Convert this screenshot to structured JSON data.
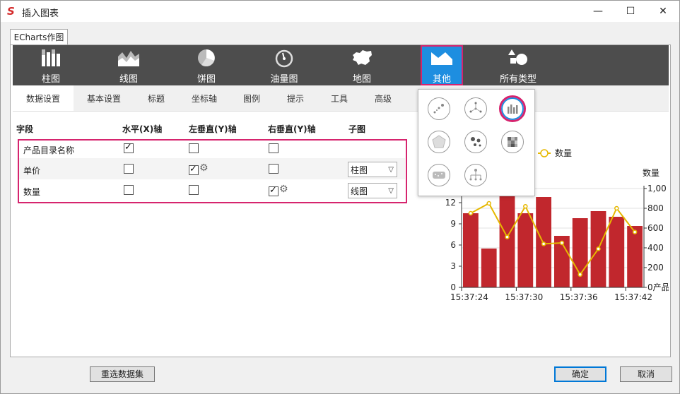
{
  "window": {
    "title": "插入图表",
    "app_icon": "S",
    "minimize": "—",
    "maximize": "☐",
    "close": "✕"
  },
  "tab": {
    "label": "ECharts作图"
  },
  "chart_types": [
    {
      "label": "柱图",
      "icon": "bar-chart-icon"
    },
    {
      "label": "线图",
      "icon": "line-chart-icon"
    },
    {
      "label": "饼图",
      "icon": "pie-chart-icon"
    },
    {
      "label": "油量图",
      "icon": "gauge-icon"
    },
    {
      "label": "地图",
      "icon": "map-icon"
    },
    {
      "label": "其他",
      "icon": "other-chart-icon",
      "selected": true
    },
    {
      "label": "所有类型",
      "icon": "all-types-icon"
    }
  ],
  "subtabs": [
    "数据设置",
    "基本设置",
    "标题",
    "坐标轴",
    "图例",
    "提示",
    "工具",
    "高级"
  ],
  "columns": {
    "field": "字段",
    "x_axis": "水平(X)轴",
    "left_y": "左垂直(Y)轴",
    "right_y": "右垂直(Y)轴",
    "sub_chart": "子图"
  },
  "rows": [
    {
      "name": "产品目录名称",
      "x": true,
      "left": false,
      "right": false,
      "sub": ""
    },
    {
      "name": "单价",
      "x": false,
      "left": true,
      "right": false,
      "sub": "柱图"
    },
    {
      "name": "数量",
      "x": false,
      "left": false,
      "right": true,
      "sub": "线图"
    }
  ],
  "preview": {
    "legend": "数量",
    "right_axis_title": "数量",
    "left_ticks": [
      "12",
      "9",
      "6",
      "3",
      "0"
    ],
    "right_ticks": [
      "1,00",
      "800",
      "600",
      "400",
      "200",
      "0产品"
    ],
    "x_ticks": [
      "15:37:24",
      "15:37:30",
      "15:37:36",
      "15:37:42"
    ],
    "bar_color": "#c1272d",
    "line_color": "#e6b800"
  },
  "chart_data": {
    "type": "bar",
    "series": [
      {
        "values": [
          10.5,
          5.5,
          13.8,
          10.5,
          12.8,
          7.3,
          9.8,
          10.8,
          10.0,
          8.7
        ]
      },
      {
        "name": "数量",
        "values": [
          750,
          850,
          510,
          820,
          440,
          450,
          130,
          390,
          800,
          560
        ]
      }
    ],
    "ylim": [
      0,
      14
    ],
    "y2lim": [
      0,
      1000
    ]
  },
  "buttons": {
    "reselect": "重选数据集",
    "ok": "确定",
    "cancel": "取消"
  }
}
